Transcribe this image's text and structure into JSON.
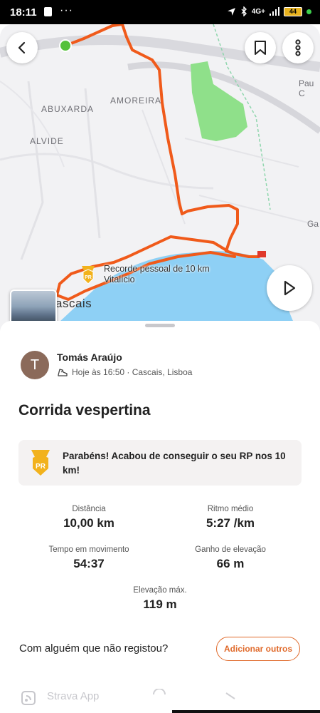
{
  "status": {
    "time": "18:11",
    "network": "4G+",
    "battery": "44"
  },
  "map": {
    "labels": [
      {
        "text": "AMOREIRA",
        "cls": ""
      },
      {
        "text": "ABUXARDA",
        "cls": ""
      },
      {
        "text": "ALVIDE",
        "cls": ""
      },
      {
        "text": "Pau C",
        "cls": ""
      },
      {
        "text": "Ga",
        "cls": ""
      },
      {
        "text": "ascais",
        "cls": "big"
      }
    ],
    "pr_label_line1": "Recorde pessoal de 10 km",
    "pr_label_line2": "Vitalício",
    "pr_badge": "PR",
    "route_color": "#f05a1a",
    "park_color": "#8fe08a",
    "sea_color": "#8ed0f5"
  },
  "activity": {
    "athlete_initial": "T",
    "athlete_name": "Tomás Araújo",
    "meta": "Hoje às 16:50 · Cascais, Lisboa",
    "title": "Corrida vespertina",
    "banner_text": "Parabéns! Acabou de conseguir o seu RP nos 10 km!",
    "banner_badge": "PR",
    "stats": [
      {
        "label": "Distância",
        "value": "10,00 km"
      },
      {
        "label": "Ritmo médio",
        "value": "5:27 /km"
      },
      {
        "label": "Tempo em movimento",
        "value": "54:37"
      },
      {
        "label": "Ganho de elevação",
        "value": "66 m"
      },
      {
        "label": "Elevação máx.",
        "value": "119 m"
      }
    ],
    "with_someone": "Com alguém que não registou?",
    "add_others": "Adicionar outros"
  },
  "footer": {
    "app_name": "Strava App"
  },
  "colors": {
    "accent": "#e06a2b",
    "badge_gold": "#f2b21c"
  }
}
